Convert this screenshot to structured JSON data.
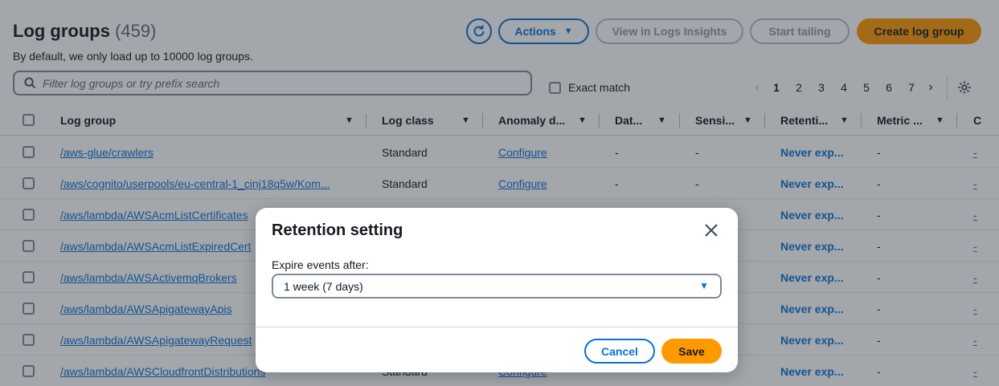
{
  "header": {
    "title": "Log groups",
    "count": "(459)",
    "subtitle": "By default, we only load up to 10000 log groups.",
    "actions_label": "Actions",
    "insights_label": "View in Logs Insights",
    "tailing_label": "Start tailing",
    "create_label": "Create log group"
  },
  "search": {
    "placeholder": "Filter log groups or try prefix search",
    "exact_match_label": "Exact match"
  },
  "pagination": {
    "pages": [
      "1",
      "2",
      "3",
      "4",
      "5",
      "6",
      "7"
    ],
    "current": "1"
  },
  "table": {
    "columns": [
      "Log group",
      "Log class",
      "Anomaly d...",
      "Dat...",
      "Sensi...",
      "Retenti...",
      "Metric ...",
      "C"
    ],
    "rows": [
      {
        "log_group": "/aws-glue/crawlers",
        "log_class": "Standard",
        "anomaly": "Configure",
        "data": "-",
        "sensitive": "-",
        "retention": "Never exp...",
        "metric": "-",
        "c": "-"
      },
      {
        "log_group": "/aws/cognito/userpools/eu-central-1_cinj18q5w/Kom...",
        "log_class": "Standard",
        "anomaly": "Configure",
        "data": "-",
        "sensitive": "-",
        "retention": "Never exp...",
        "metric": "-",
        "c": "-"
      },
      {
        "log_group": "/aws/lambda/AWSAcmListCertificates",
        "log_class": "",
        "anomaly": "",
        "data": "",
        "sensitive": "",
        "retention": "Never exp...",
        "metric": "-",
        "c": "-"
      },
      {
        "log_group": "/aws/lambda/AWSAcmListExpiredCert",
        "log_class": "",
        "anomaly": "",
        "data": "",
        "sensitive": "",
        "retention": "Never exp...",
        "metric": "-",
        "c": "-"
      },
      {
        "log_group": "/aws/lambda/AWSActivemqBrokers",
        "log_class": "",
        "anomaly": "",
        "data": "",
        "sensitive": "",
        "retention": "Never exp...",
        "metric": "-",
        "c": "-"
      },
      {
        "log_group": "/aws/lambda/AWSApigatewayApis",
        "log_class": "",
        "anomaly": "",
        "data": "",
        "sensitive": "",
        "retention": "Never exp...",
        "metric": "-",
        "c": "-"
      },
      {
        "log_group": "/aws/lambda/AWSApigatewayRequest",
        "log_class": "",
        "anomaly": "",
        "data": "",
        "sensitive": "",
        "retention": "Never exp...",
        "metric": "-",
        "c": "-"
      },
      {
        "log_group": "/aws/lambda/AWSCloudfrontDistributions",
        "log_class": "Standard",
        "anomaly": "Configure",
        "data": "",
        "sensitive": "",
        "retention": "Never exp...",
        "metric": "-",
        "c": "-"
      }
    ]
  },
  "modal": {
    "title": "Retention setting",
    "field_label": "Expire events after:",
    "selected_value": "1 week (7 days)",
    "cancel_label": "Cancel",
    "save_label": "Save"
  },
  "colors": {
    "accent": "#0972d3",
    "primary_button": "#ff9900",
    "overlay": "#232b37"
  },
  "icons": [
    "refresh-icon",
    "caret-down-icon",
    "search-icon",
    "chevron-left-icon",
    "chevron-right-icon",
    "gear-icon",
    "sort-icon",
    "close-icon"
  ]
}
